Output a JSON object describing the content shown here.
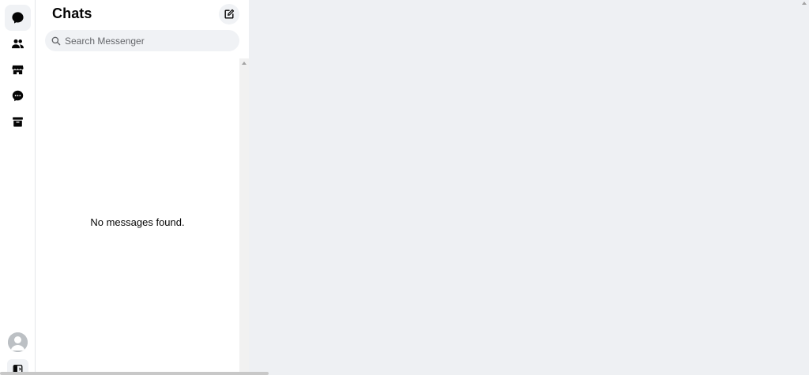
{
  "nav": {
    "items": [
      {
        "icon": "chat-bubble-icon",
        "active": true
      },
      {
        "icon": "people-icon",
        "active": false
      },
      {
        "icon": "marketplace-store-icon",
        "active": false
      },
      {
        "icon": "message-requests-icon",
        "active": false
      },
      {
        "icon": "archive-icon",
        "active": false
      }
    ],
    "avatar_icon": "user-avatar-icon",
    "collapse_icon": "sidebar-toggle-icon"
  },
  "chats": {
    "title": "Chats",
    "compose_icon": "new-message-icon",
    "search": {
      "placeholder": "Search Messenger",
      "value": "",
      "icon": "search-icon"
    },
    "empty_message": "No messages found."
  },
  "colors": {
    "panel_bg": "#ffffff",
    "main_bg": "#eef0f3",
    "hover_bg": "#f0f2f5",
    "text_primary": "#050505",
    "text_secondary": "#65676b"
  }
}
